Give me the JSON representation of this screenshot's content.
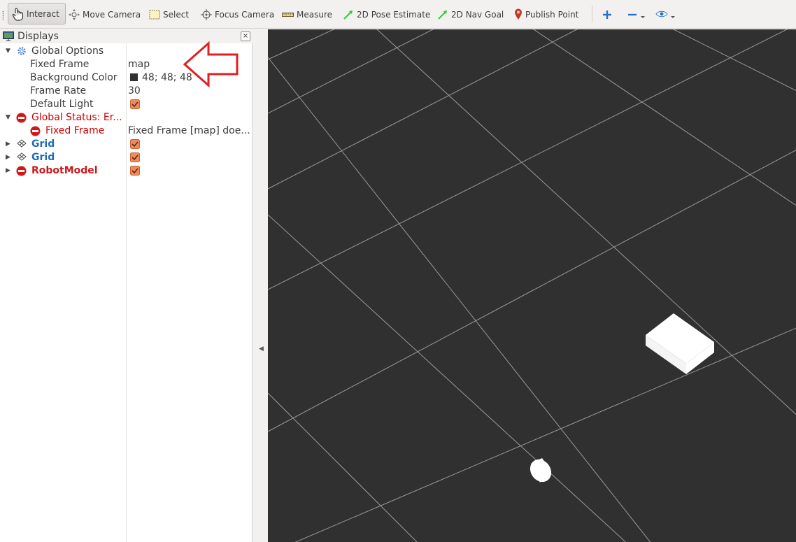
{
  "toolbar": {
    "tools": [
      {
        "label": "Interact",
        "icon": "hand-pointer-icon"
      },
      {
        "label": "Move Camera",
        "icon": "move-camera-icon"
      },
      {
        "label": "Select",
        "icon": "select-rectangle-icon"
      },
      {
        "label": "Focus Camera",
        "icon": "focus-camera-icon"
      },
      {
        "label": "Measure",
        "icon": "ruler-icon"
      },
      {
        "label": "2D Pose Estimate",
        "icon": "green-arrow-icon"
      },
      {
        "label": "2D Nav Goal",
        "icon": "green-arrow-icon"
      },
      {
        "label": "Publish Point",
        "icon": "map-pin-icon"
      }
    ],
    "extra_icons": [
      "add-tool-icon",
      "remove-tool-icon",
      "view-eye-icon"
    ],
    "colors": {
      "pose_arrow": "#2ecc2e",
      "pin": "#c0392b",
      "plus_blue": "#2a6fc9"
    }
  },
  "displays_panel": {
    "title": "Displays",
    "close_glyph": "×",
    "tree": [
      {
        "name": "Global Options",
        "icon": "gear-icon",
        "expanded": true
      },
      {
        "name": "Fixed Frame",
        "value": "map"
      },
      {
        "name": "Background Color",
        "value": "48; 48; 48",
        "color": "#303030"
      },
      {
        "name": "Frame Rate",
        "value": "30"
      },
      {
        "name": "Default Light",
        "checked": true
      },
      {
        "name": "Global Status: Er...",
        "icon": "error-icon",
        "expanded": true
      },
      {
        "name": "Fixed Frame",
        "value": "Fixed Frame [map] doe...",
        "icon": "error-icon"
      },
      {
        "name": "Grid",
        "icon": "grid-icon",
        "checked": true
      },
      {
        "name": "Grid",
        "icon": "grid-icon",
        "checked": true
      },
      {
        "name": "RobotModel",
        "icon": "error-icon",
        "checked": true
      }
    ]
  },
  "viewport": {
    "background": "#303030",
    "grid_color": "#a0a0a0"
  },
  "colors": {
    "error": "#cc0000",
    "display_blue": "#1f6bb5",
    "checkbox": "#f08a5d",
    "annotation_arrow": "#e02020"
  }
}
